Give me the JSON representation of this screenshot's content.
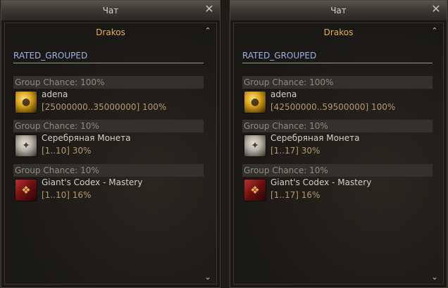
{
  "windows": [
    {
      "title": "Чат",
      "npc_name": "Drakos",
      "category": "RATED_GROUPED",
      "groups": [
        {
          "chance_text": "Group Chance: 100%",
          "item": {
            "icon": "adena-coins-icon",
            "name": "adena",
            "drop": "[25000000..35000000] 100%"
          }
        },
        {
          "chance_text": "Group Chance: 10%",
          "item": {
            "icon": "silver-coin-icon",
            "name": "Серебряная Монета",
            "drop": "[1..10] 30%"
          }
        },
        {
          "chance_text": "Group Chance: 10%",
          "item": {
            "icon": "codex-book-icon",
            "name": "Giant's Codex - Mastery",
            "drop": "[1..10] 16%"
          }
        }
      ]
    },
    {
      "title": "Чат",
      "npc_name": "Drakos",
      "category": "RATED_GROUPED",
      "groups": [
        {
          "chance_text": "Group Chance: 100%",
          "item": {
            "icon": "adena-coins-icon",
            "name": "adena",
            "drop": "[42500000..59500000] 100%"
          }
        },
        {
          "chance_text": "Group Chance: 10%",
          "item": {
            "icon": "silver-coin-icon",
            "name": "Серебряная Монета",
            "drop": "[1..17] 30%"
          }
        },
        {
          "chance_text": "Group Chance: 10%",
          "item": {
            "icon": "codex-book-icon",
            "name": "Giant's Codex - Mastery",
            "drop": "[1..17] 16%"
          }
        }
      ]
    }
  ],
  "glyphs": {
    "close": "✕",
    "collapse": "⌃",
    "scroll_down": "⌄"
  },
  "colors": {
    "npc_name": "#e6b24a",
    "category": "#9fb0e6",
    "drop_text": "#b49a6a"
  }
}
